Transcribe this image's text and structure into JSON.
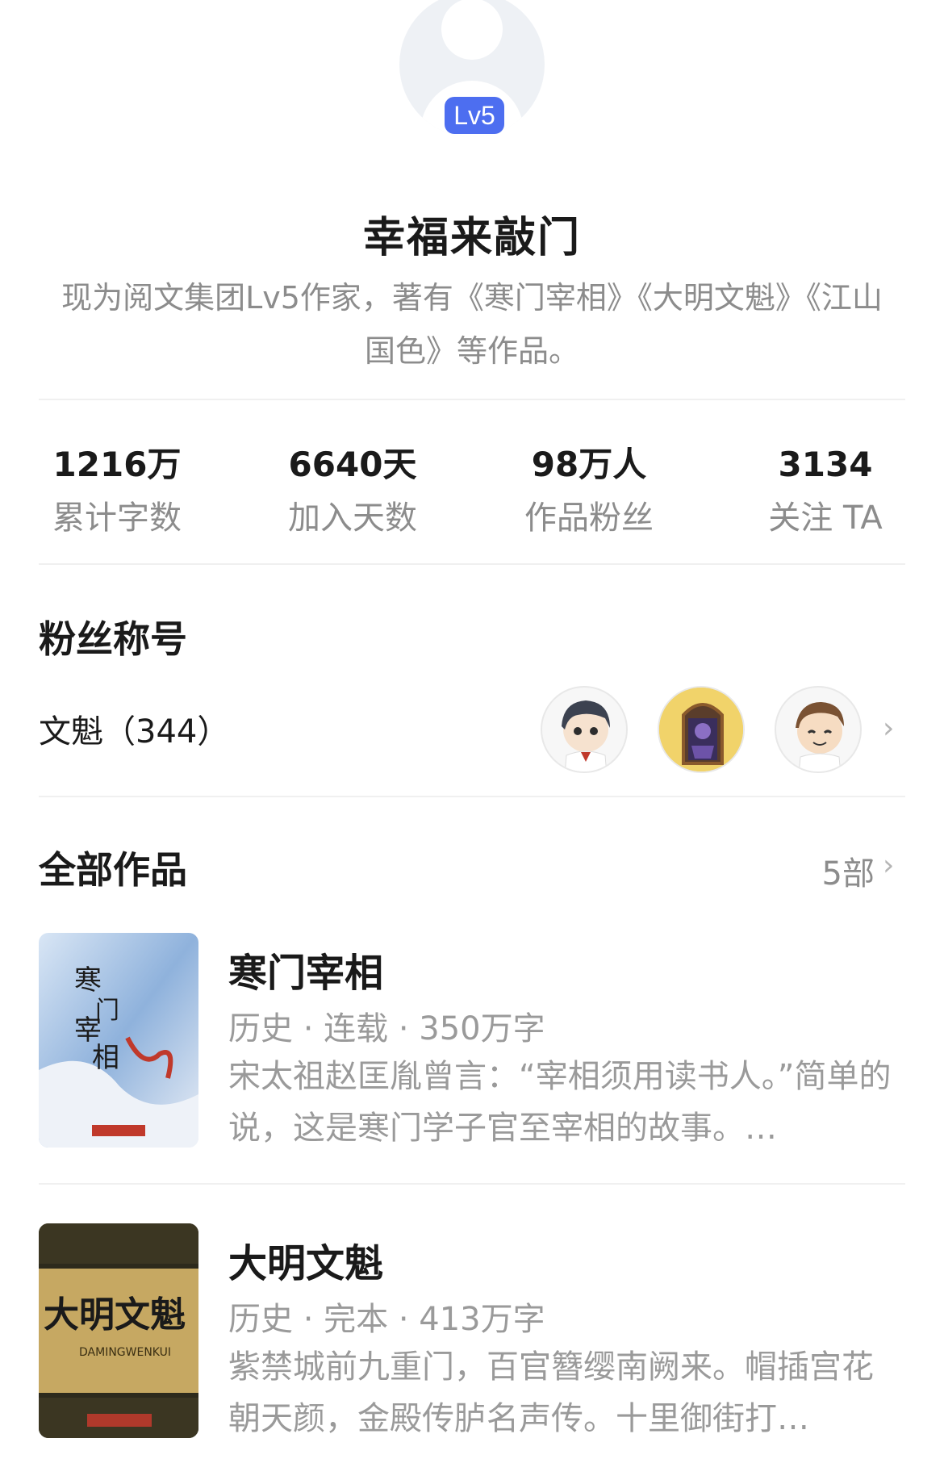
{
  "profile": {
    "level_badge": "Lv5",
    "name": "幸福来敲门",
    "bio": "现为阅文集团Lv5作家，著有《寒门宰相》《大明文魁》《江山国色》等作品。"
  },
  "stats": [
    {
      "value": "1216万",
      "label": "累计字数"
    },
    {
      "value": "6640天",
      "label": "加入天数"
    },
    {
      "value": "98万人",
      "label": "作品粉丝"
    },
    {
      "value": "3134",
      "label": "关注 TA"
    }
  ],
  "fans": {
    "title": "粉丝称号",
    "rank_label": "文魁（344）",
    "avatars": [
      "fan-avatar-boy",
      "fan-avatar-knight",
      "fan-avatar-smile"
    ]
  },
  "works": {
    "title": "全部作品",
    "count": "5部",
    "books": [
      {
        "title": "寒门宰相",
        "meta": "历史 · 连载 · 350万字",
        "desc": "宋太祖赵匡胤曾言：“宰相须用读书人。”简单的说，这是寒门学子官至宰相的故事。…",
        "cover_title": "寒门宰相"
      },
      {
        "title": "大明文魁",
        "meta": "历史 · 完本 · 413万字",
        "desc": "紫禁城前九重门，百官簪缨南阙来。帽插宫花朝天颜，金殿传胪名声传。十里御街打…",
        "cover_title": "大明文魁"
      }
    ]
  },
  "icons": {
    "chevron": "chevron-right-icon"
  },
  "colors": {
    "accent": "#4d6ef0",
    "secondary_text": "#8c8c8c"
  }
}
